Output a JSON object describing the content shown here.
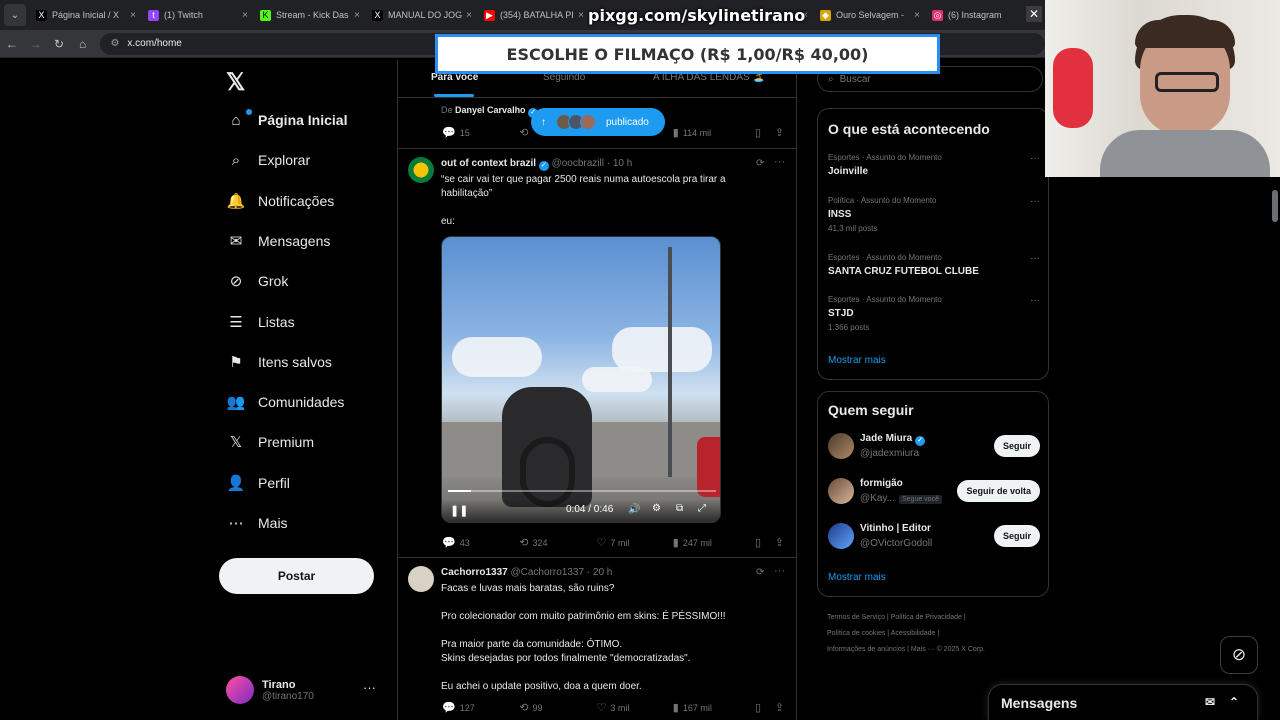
{
  "browser": {
    "tabs": [
      {
        "title": "Página Inicial / X",
        "fav": "X",
        "active": false
      },
      {
        "title": "(1) Twitch",
        "fav": "t",
        "active": false
      },
      {
        "title": "Stream - Kick Das",
        "fav": "K",
        "active": false
      },
      {
        "title": "MANUAL DO JOG",
        "fav": "X",
        "active": false
      },
      {
        "title": "(354) BATALHA PI",
        "fav": "▶",
        "active": false
      },
      {
        "title": "",
        "fav": "",
        "active": false
      },
      {
        "title": "",
        "fav": "",
        "active": false
      },
      {
        "title": "Ouro Selvagem -",
        "fav": "◆",
        "active": false
      },
      {
        "title": "(6) Instagram",
        "fav": "◎",
        "active": false
      }
    ],
    "close_glyph": "×",
    "url": "x.com/home"
  },
  "overlay": {
    "pix_text": "pixgg.com/skylinetirano",
    "banner_text": "ESCOLHE O FILMAÇO (R$ 1,00/R$ 40,00)"
  },
  "sidebar": {
    "items": [
      {
        "label": "Página Inicial",
        "icon": "home-icon"
      },
      {
        "label": "Explorar",
        "icon": "search-icon"
      },
      {
        "label": "Notificações",
        "icon": "bell-icon"
      },
      {
        "label": "Mensagens",
        "icon": "mail-icon"
      },
      {
        "label": "Grok",
        "icon": "grok-icon"
      },
      {
        "label": "Listas",
        "icon": "list-icon"
      },
      {
        "label": "Itens salvos",
        "icon": "bookmark-icon"
      },
      {
        "label": "Comunidades",
        "icon": "people-icon"
      },
      {
        "label": "Premium",
        "icon": "x-logo-icon"
      },
      {
        "label": "Perfil",
        "icon": "person-icon"
      },
      {
        "label": "Mais",
        "icon": "more-circle-icon"
      }
    ],
    "post_label": "Postar",
    "profile": {
      "name": "Tirano",
      "handle": "@tirano170",
      "more": "···"
    }
  },
  "feed": {
    "tabs": [
      "Para você",
      "Seguindo",
      "A ILHA DAS LENDAS 🏝️"
    ],
    "top_tweet": {
      "prefix": "De",
      "author": "Danyel Carvalho",
      "replies": "15",
      "views": "114 mil"
    },
    "new_posts_pill": "publicado",
    "tweets": [
      {
        "name": "out of context brazil",
        "handle": "@oocbrazill",
        "time": "· 10 h",
        "lines": [
          "“se cair vai ter que pagar 2500 reais numa autoescola pra tirar a",
          "habilitação”",
          "",
          "eu:"
        ],
        "video_time": "0:04 / 0:46",
        "video_progress": 0.087,
        "replies": "43",
        "retweets": "324",
        "likes": "7 mil",
        "views": "247 mil"
      },
      {
        "name": "Cachorro1337",
        "handle": "@Cachorro1337",
        "time": "· 20 h",
        "lines": [
          "Facas e luvas mais baratas, são ruins?",
          "",
          "Pro colecionador com muito patrimônio em skins: É PÉSSIMO!!!",
          "",
          "Pra maior parte da comunidade: ÓTIMO.",
          "Skins desejadas por todos finalmente \"democratizadas\".",
          "",
          "Eu achei o update positivo, doa a quem doer."
        ],
        "replies": "127",
        "retweets": "99",
        "likes": "3 mil",
        "views": "167 mil"
      }
    ]
  },
  "right": {
    "search_placeholder": "Buscar",
    "trends_title": "O que está acontecendo",
    "trends": [
      {
        "category": "Esportes · Assunto do Momento",
        "name": "Joinville",
        "count": ""
      },
      {
        "category": "Política · Assunto do Momento",
        "name": "INSS",
        "count": "41,3 mil posts"
      },
      {
        "category": "Esportes · Assunto do Momento",
        "name": "SANTA CRUZ FUTEBOL CLUBE",
        "count": ""
      },
      {
        "category": "Esportes · Assunto do Momento",
        "name": "STJD",
        "count": "1.366 posts"
      }
    ],
    "show_more": "Mostrar mais",
    "follow_title": "Quem seguir",
    "follow": [
      {
        "name": "Jade Miura",
        "handle": "@jadexmiura",
        "button": "Seguir",
        "badge": ""
      },
      {
        "name": "formigão",
        "handle": "@Kay...",
        "button": "Seguir de volta",
        "badge": "Segue você"
      },
      {
        "name": "Vitinho | Editor",
        "handle": "@OVictorGodoll",
        "button": "Seguir",
        "badge": ""
      }
    ],
    "footer_lines": [
      "Termos de Serviço  |  Política de Privacidade  |",
      "Política de cookies  |  Acessibilidade  |",
      "Informações de anúncios  |  Mais ···  © 2025 X Corp."
    ]
  },
  "messages_label": "Mensagens",
  "colors": {
    "accent": "#1d9bf0",
    "background": "#000000",
    "border": "#2f3336"
  }
}
